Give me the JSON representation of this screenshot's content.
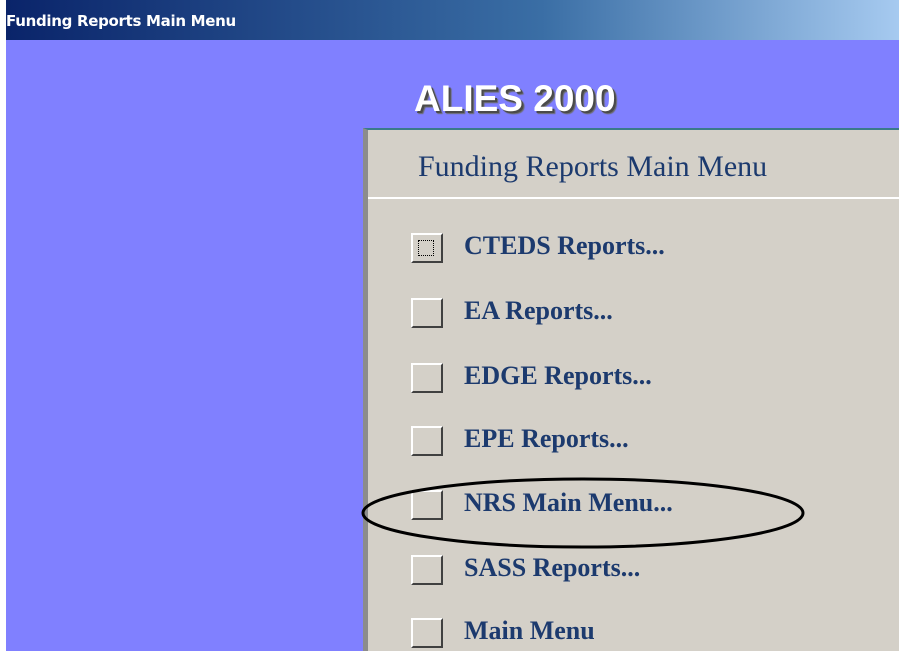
{
  "window": {
    "title": "Funding Reports Main Menu"
  },
  "app": {
    "name": "ALIES 2000"
  },
  "menu": {
    "heading": "Funding Reports Main Menu",
    "items": [
      {
        "label": "CTEDS Reports...",
        "focused": true
      },
      {
        "label": "EA Reports...",
        "focused": false
      },
      {
        "label": "EDGE Reports...",
        "focused": false
      },
      {
        "label": "EPE Reports...",
        "focused": false
      },
      {
        "label": "NRS Main Menu...",
        "focused": false
      },
      {
        "label": "SASS Reports...",
        "focused": false
      },
      {
        "label": "Main Menu",
        "focused": false
      }
    ]
  },
  "colors": {
    "form_background": "#8080ff",
    "panel_background": "#d4d0c8",
    "label_text": "#1c3a6e"
  },
  "annotation": {
    "highlighted_item": "NRS Main Menu..."
  }
}
